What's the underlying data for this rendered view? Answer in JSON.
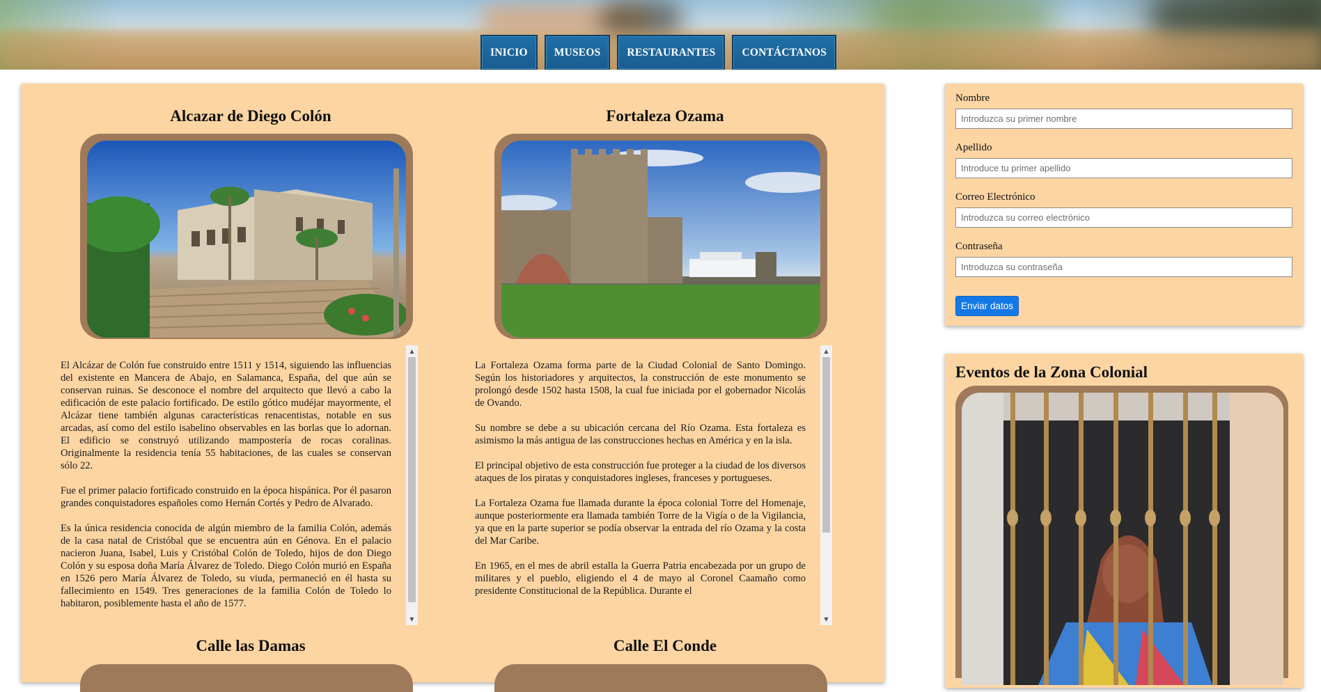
{
  "nav": {
    "items": [
      "INICIO",
      "MUSEOS",
      "RESTAURANTES",
      "CONTÁCTANOS"
    ]
  },
  "articles": [
    {
      "title": "Alcazar de Diego Colón",
      "paragraphs": [
        "El Alcázar de Colón fue construido entre 1511 y 1514, siguiendo las influencias del existente en Mancera de Abajo, en Salamanca, España, del que aún se conservan ruinas. Se desconoce el nombre del arquitecto que llevó a cabo la edificación de este palacio fortificado. De estilo gótico mudéjar mayormente, el Alcázar tiene también algunas características renacentistas, notable en sus arcadas, así como del estilo isabelino observables en las borlas que lo adornan. El edificio se construyó utilizando mampostería de rocas coralinas. Originalmente la residencia tenía 55 habitaciones, de las cuales se conservan sólo 22.",
        "Fue el primer palacio fortificado construido en la época hispánica. Por él pasaron grandes conquistadores españoles como Hernán Cortés y Pedro de Alvarado.",
        "Es la única residencia conocida de algún miembro de la familia Colón, además de la casa natal de Cristóbal que se encuentra aún en Génova. En el palacio nacieron Juana, Isabel, Luis y Cristóbal Colón de Toledo, hijos de don Diego Colón y su esposa doña María Álvarez de Toledo. Diego Colón murió en España en 1526 pero María Álvarez de Toledo, su viuda, permaneció en él hasta su fallecimiento en 1549. Tres generaciones de la familia Colón de Toledo lo habitaron, posiblemente hasta el año de 1577."
      ]
    },
    {
      "title": "Fortaleza Ozama",
      "paragraphs": [
        "La Fortaleza Ozama forma parte de la Ciudad Colonial de Santo Domingo. Según los historiadores y arquitectos, la construcción de este monumento se prolongó desde 1502 hasta 1508, la cual fue iniciada por el gobernador Nicolás de Ovando.",
        "Su nombre se debe a su ubicación cercana del Río Ozama. Esta fortaleza es asimismo la más antigua de las construcciones hechas en América y en la isla.",
        "El principal objetivo de esta construcción fue proteger a la ciudad de los diversos ataques de los piratas y conquistadores ingleses, franceses y portugueses.",
        "La Fortaleza Ozama fue llamada durante la época colonial Torre del Homenaje, aunque posteriormente era llamada también Torre de la Vigía o de la Vigilancia, ya que en la parte superior se podía observar la entrada del río Ozama y la costa del Mar Caribe.",
        "En 1965, en el mes de abril estalla la Guerra Patria encabezada por un grupo de militares y el pueblo, eligiendo el 4 de mayo al Coronel Caamaño como presidente Constitucional de la República. Durante el"
      ]
    }
  ],
  "next_articles": [
    "Calle las Damas",
    "Calle El Conde"
  ],
  "form": {
    "fields": [
      {
        "label": "Nombre",
        "placeholder": "Introduzca su primer nombre",
        "value": ""
      },
      {
        "label": "Apellido",
        "placeholder": "Introduce tu primer apellido",
        "value": ""
      },
      {
        "label": "Correo Electrónico",
        "placeholder": "Introduzca su correo electrónico",
        "value": ""
      },
      {
        "label": "Contraseña",
        "placeholder": "Introduzca su contraseña",
        "value": ""
      }
    ],
    "submit_label": "Enviar datos"
  },
  "events": {
    "title": "Eventos de la Zona Colonial"
  },
  "colors": {
    "panel_bg": "#fdd5a3",
    "nav_bg": "#1a5d8e",
    "submit_bg": "#1479e6",
    "frame": "#9e7a5b"
  }
}
